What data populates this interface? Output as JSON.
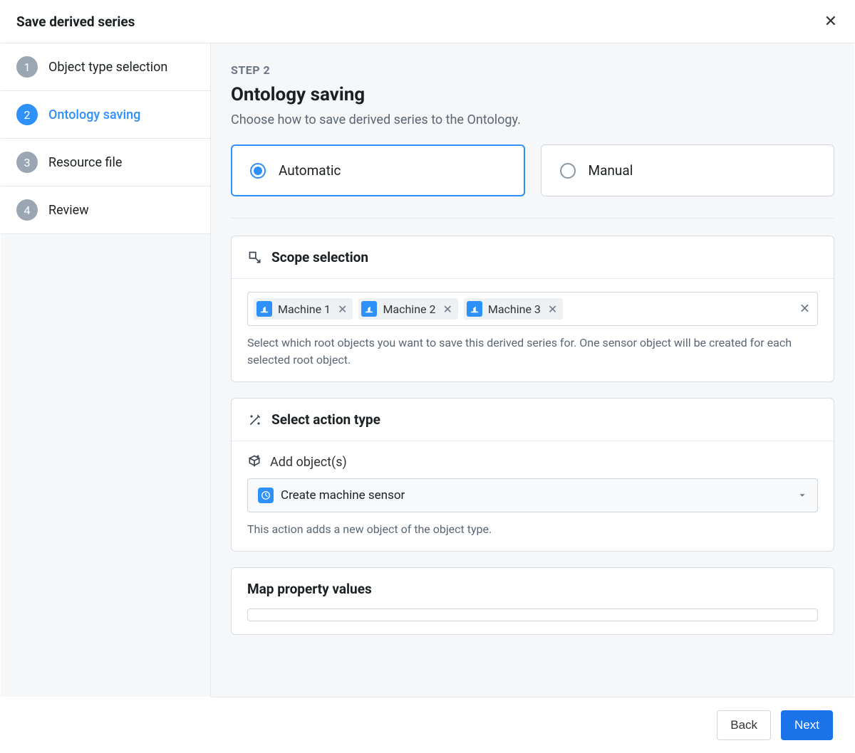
{
  "dialog": {
    "title": "Save derived series"
  },
  "steps": [
    {
      "num": "1",
      "label": "Object type selection"
    },
    {
      "num": "2",
      "label": "Ontology saving"
    },
    {
      "num": "3",
      "label": "Resource file"
    },
    {
      "num": "4",
      "label": "Review"
    }
  ],
  "active_step_index": 1,
  "page": {
    "kicker": "STEP 2",
    "title": "Ontology saving",
    "subtitle": "Choose how to save derived series to the Ontology."
  },
  "modes": {
    "automatic": "Automatic",
    "manual": "Manual",
    "selected": "automatic"
  },
  "scope": {
    "title": "Scope selection",
    "chips": [
      "Machine 1",
      "Machine 2",
      "Machine 3"
    ],
    "help": "Select which root objects you want to save this derived series for. One sensor object will be created for each selected root object."
  },
  "action": {
    "title": "Select action type",
    "subhead": "Add object(s)",
    "selected": "Create machine sensor",
    "help": "This action adds a new object of the object type."
  },
  "map_section": {
    "title": "Map property values"
  },
  "footer": {
    "back": "Back",
    "next": "Next"
  }
}
